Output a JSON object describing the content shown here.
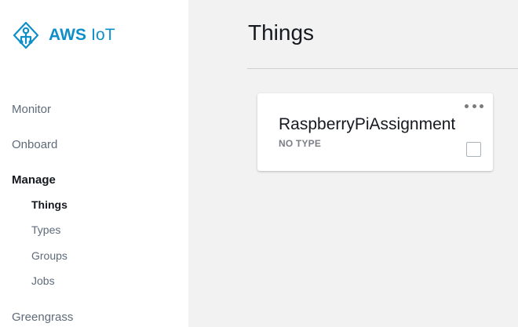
{
  "brand": {
    "name_bold": "AWS",
    "name_light": "IoT",
    "icon": "aws-iot-logo-icon",
    "accent_color": "#0f8fc8"
  },
  "sidebar": {
    "monitor": "Monitor",
    "onboard": "Onboard",
    "manage": "Manage",
    "manage_items": [
      {
        "label": "Things",
        "active": true
      },
      {
        "label": "Types"
      },
      {
        "label": "Groups"
      },
      {
        "label": "Jobs"
      }
    ],
    "greengrass": "Greengrass"
  },
  "main": {
    "title": "Things",
    "things": [
      {
        "name": "RaspberryPiAssignment",
        "type": "NO TYPE",
        "menu_icon": "more-options-icon"
      }
    ]
  }
}
